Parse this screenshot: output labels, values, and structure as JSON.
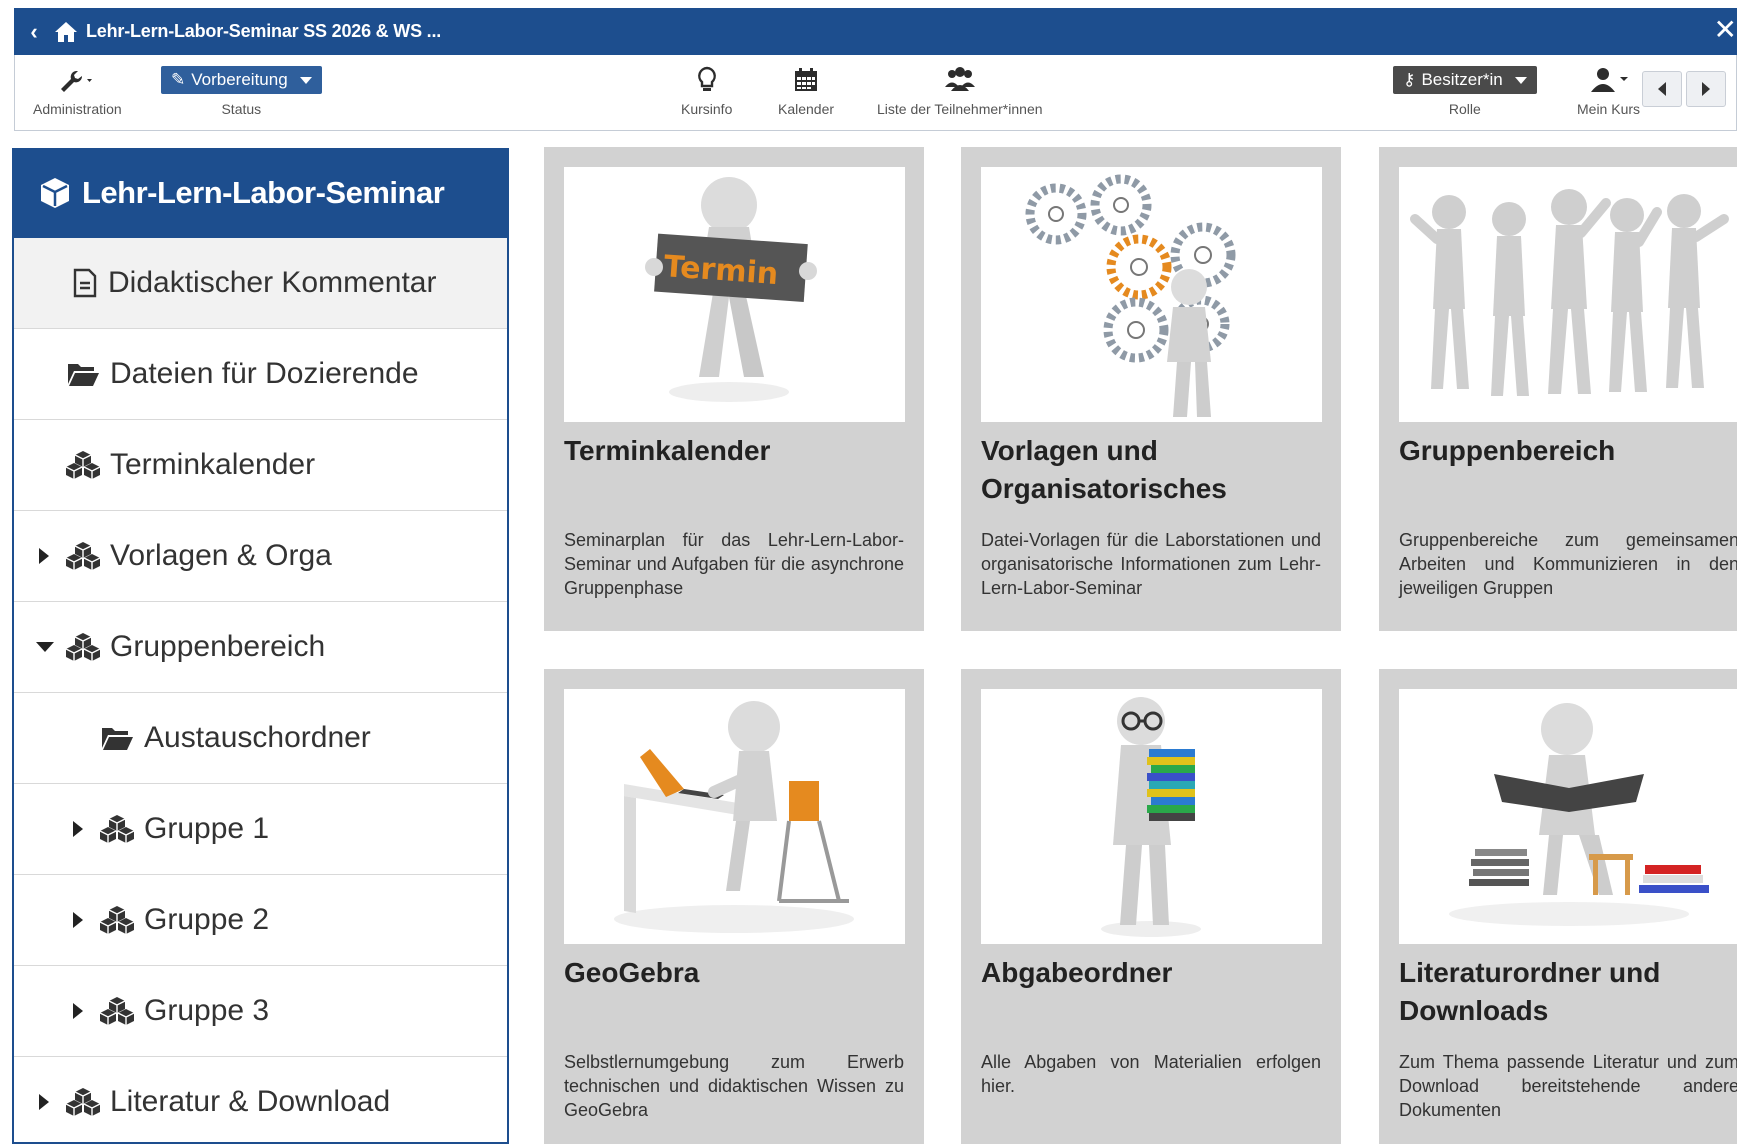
{
  "topbar": {
    "breadcrumb": "Lehr-Lern-Labor-Seminar SS 2026 & WS ..."
  },
  "toolbar": {
    "administration": "Administration",
    "status_value": "Vorbereitung",
    "status_label": "Status",
    "kursinfo": "Kursinfo",
    "kalender": "Kalender",
    "teilnehmer": "Liste der Teilnehmer*innen",
    "role_value": "Besitzer*in",
    "role_label": "Rolle",
    "mein_kurs": "Mein Kurs"
  },
  "sidebar": {
    "title": "Lehr-Lern-Labor-Seminar",
    "items": [
      {
        "label": "Didaktischer Kommentar"
      },
      {
        "label": "Dateien für Dozierende"
      },
      {
        "label": "Terminkalender"
      },
      {
        "label": "Vorlagen & Orga"
      },
      {
        "label": "Gruppenbereich"
      },
      {
        "label": "Austauschordner"
      },
      {
        "label": "Gruppe 1"
      },
      {
        "label": "Gruppe 2"
      },
      {
        "label": "Gruppe 3"
      },
      {
        "label": "Literatur & Download"
      }
    ]
  },
  "cards": [
    {
      "title": "Terminkalender",
      "desc": "Seminarplan für das Lehr-Lern-Labor-Seminar und Aufgaben für die asynchrone Gruppenphase",
      "sign": "Termin"
    },
    {
      "title": "Vorlagen und Organisatorisches",
      "desc": "Datei-Vorlagen für die Laborstationen und organisatorische Informationen zum Lehr-Lern-Labor-Seminar"
    },
    {
      "title": "Gruppenbereich",
      "desc": "Gruppenbereiche zum gemeinsamen Arbeiten und Kommunizieren in den jeweiligen Gruppen"
    },
    {
      "title": "GeoGebra",
      "desc": "Selbstlernumgebung zum Erwerb technischen und didaktischen Wissen zu GeoGebra"
    },
    {
      "title": "Abgabeordner",
      "desc": "Alle Abgaben von Materialien erfolgen hier."
    },
    {
      "title": "Literaturordner und Downloads",
      "desc": "Zum Thema passende Literatur und zum Download bereitstehende andere Dokumenten"
    }
  ],
  "colors": {
    "primary": "#1d4e8e",
    "card_bg": "#d2d2d2",
    "accent_orange": "#e58a1f"
  }
}
